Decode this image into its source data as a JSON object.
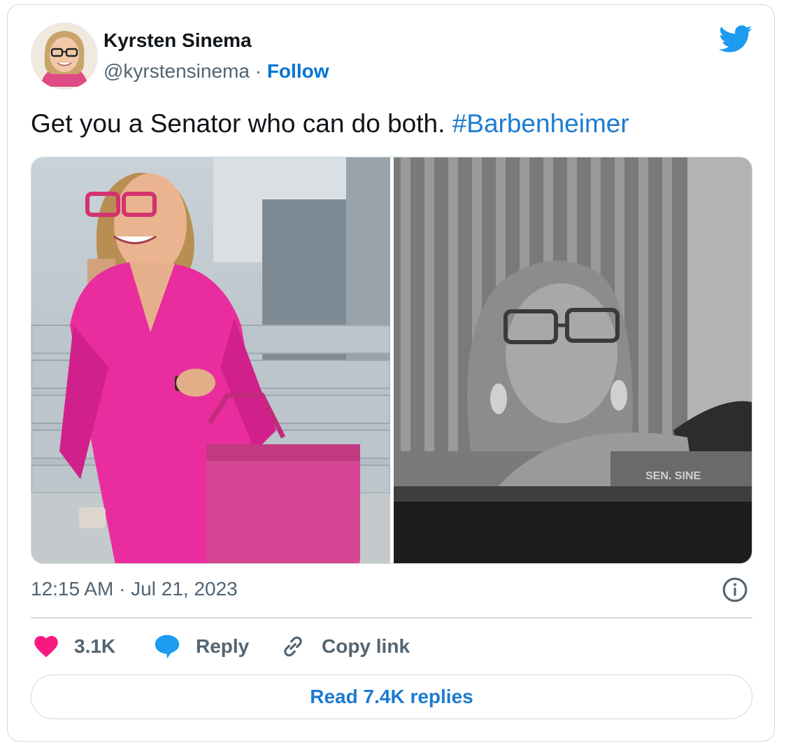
{
  "tweet": {
    "author": {
      "name": "Kyrsten Sinema",
      "handle": "@kyrstensinema",
      "separator": "·",
      "follow_label": "Follow",
      "avatar_icon": "profile-photo"
    },
    "text": "Get you a Senator who can do both. ",
    "hashtag": "#Barbenheimer",
    "media": [
      {
        "kind": "photo",
        "style": "color"
      },
      {
        "kind": "photo",
        "style": "black-and-white"
      }
    ],
    "photo_nameplate": "SEN. SINE",
    "timestamp": "12:15 AM · Jul 21, 2023",
    "actions": {
      "like_count": "3.1K",
      "reply_label": "Reply",
      "copy_label": "Copy link"
    },
    "read_replies_label": "Read 7.4K replies"
  },
  "colors": {
    "brand": "#1d9bf0",
    "link": "#1d7bd1",
    "like": "#f91880",
    "text_secondary": "#536471",
    "border": "#cfd9de"
  },
  "icons": [
    "twitter-bird-icon",
    "info-icon",
    "heart-icon",
    "reply-bubble-icon",
    "link-icon"
  ]
}
